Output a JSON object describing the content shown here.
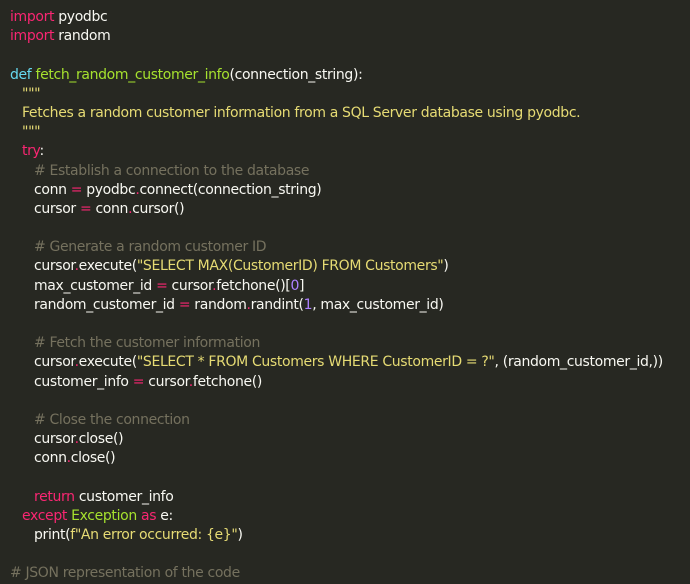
{
  "code": {
    "l01": {
      "kw": "import",
      "rest": " pyodbc"
    },
    "l02": {
      "kw": "import",
      "rest": " random"
    },
    "l04": {
      "def": "def",
      "name": " fetch_random_customer_info",
      "args": "(connection_string):"
    },
    "l05": "\"\"\"",
    "l06": "Fetches a random customer information from a SQL Server database using pyodbc.",
    "l07": "\"\"\"",
    "l08": {
      "kw": "try",
      "rest": ":"
    },
    "l09": "# Establish a connection to the database",
    "l10": {
      "a": "conn ",
      "op": "=",
      "b": " pyodbc",
      "c": ".",
      "d": "connect(connection_string)"
    },
    "l11": {
      "a": "cursor ",
      "op": "=",
      "b": " conn",
      "c": ".",
      "d": "cursor()"
    },
    "l13": "# Generate a random customer ID",
    "l14": {
      "a": "cursor",
      "c": ".",
      "d": "execute(",
      "s": "\"SELECT MAX(CustomerID) FROM Customers\"",
      "e": ")"
    },
    "l15": {
      "a": "max_customer_id ",
      "op": "=",
      "b": " cursor",
      "c": ".",
      "d": "fetchone()[",
      "n": "0",
      "e": "]"
    },
    "l16": {
      "a": "random_customer_id ",
      "op": "=",
      "b": " random",
      "c": ".",
      "d": "randint(",
      "n": "1",
      "e": ", max_customer_id)"
    },
    "l18": "# Fetch the customer information",
    "l19": {
      "a": "cursor",
      "c": ".",
      "d": "execute(",
      "s": "\"SELECT * FROM Customers WHERE CustomerID = ?\"",
      "e": ", (random_customer_id,))"
    },
    "l20": {
      "a": "customer_info ",
      "op": "=",
      "b": " cursor",
      "c": ".",
      "d": "fetchone()"
    },
    "l22": "# Close the connection",
    "l23": {
      "a": "cursor",
      "c": ".",
      "d": "close()"
    },
    "l24": {
      "a": "conn",
      "c": ".",
      "d": "close()"
    },
    "l26": {
      "kw": "return",
      "rest": " customer_info"
    },
    "l27": {
      "kw": "except",
      "cls": " Exception",
      "kw2": " as",
      "rest": " e:"
    },
    "l28": {
      "a": "print(",
      "s": "f\"An error occurred: {e}\"",
      "e": ")"
    },
    "l30": "# JSON representation of the code"
  },
  "colors": {
    "background": "#272822",
    "keyword": "#f92672",
    "function": "#a6e22e",
    "def": "#66d9ef",
    "string": "#e6db74",
    "comment": "#75715e",
    "number": "#ae81ff",
    "text": "#f8f8f2"
  }
}
